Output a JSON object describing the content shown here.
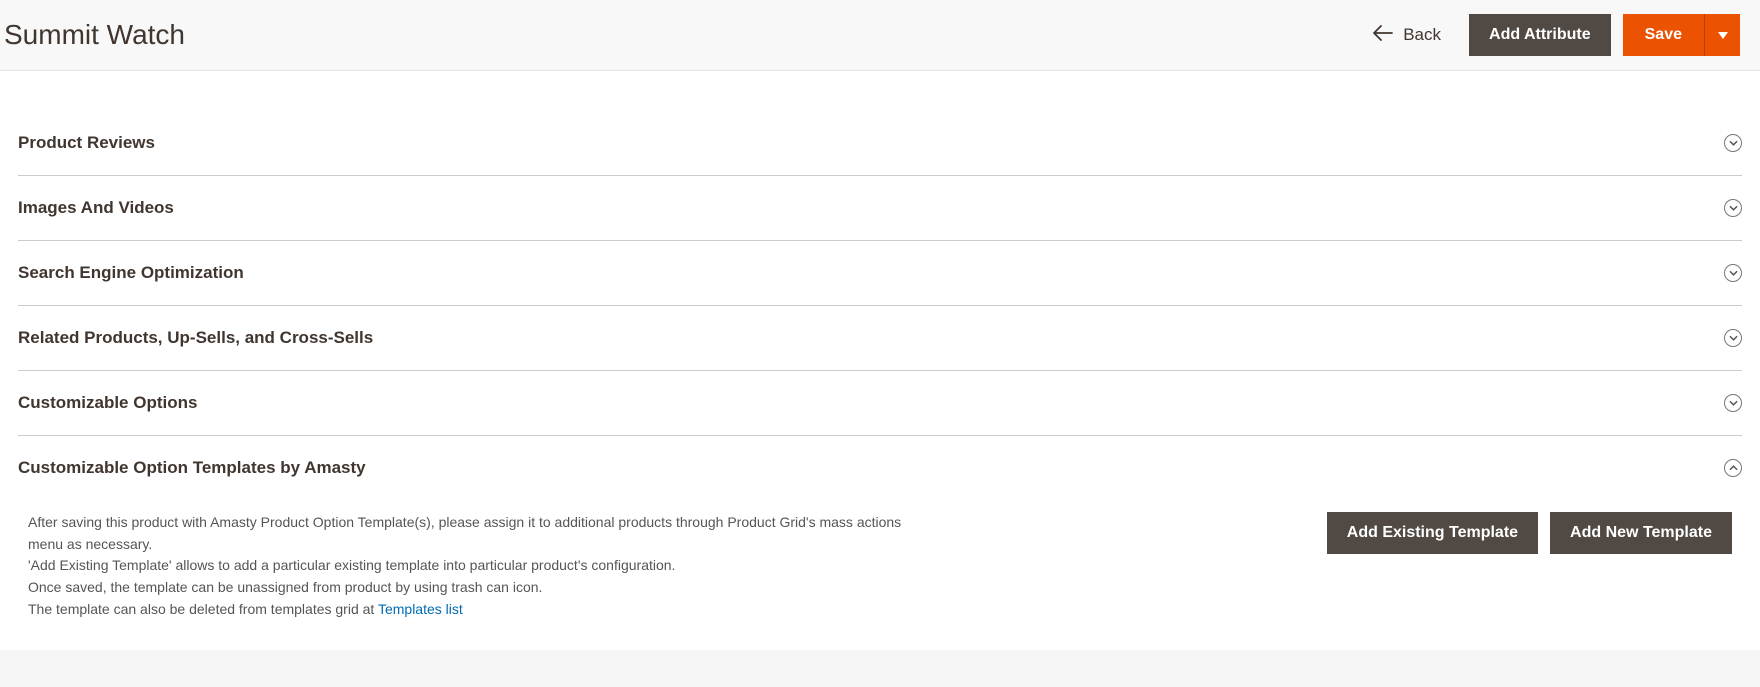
{
  "header": {
    "title": "Summit Watch",
    "back_label": "Back",
    "add_attribute_label": "Add Attribute",
    "save_label": "Save"
  },
  "sections": [
    {
      "title": "Product Reviews",
      "expanded": false
    },
    {
      "title": "Images And Videos",
      "expanded": false
    },
    {
      "title": "Search Engine Optimization",
      "expanded": false
    },
    {
      "title": "Related Products, Up-Sells, and Cross-Sells",
      "expanded": false
    },
    {
      "title": "Customizable Options",
      "expanded": false
    },
    {
      "title": "Customizable Option Templates by Amasty",
      "expanded": true
    }
  ],
  "amasty_body": {
    "line1": "After saving this product with Amasty Product Option Template(s), please assign it to additional products through Product Grid's mass actions menu as necessary.",
    "line2": "'Add Existing Template' allows to add a particular existing template into particular product's configuration.",
    "line3": "Once saved, the template can be unassigned from product by using trash can icon.",
    "line4_prefix": "The template can also be deleted from templates grid at ",
    "line4_link": "Templates list",
    "add_existing_label": "Add Existing Template",
    "add_new_label": "Add New Template"
  }
}
